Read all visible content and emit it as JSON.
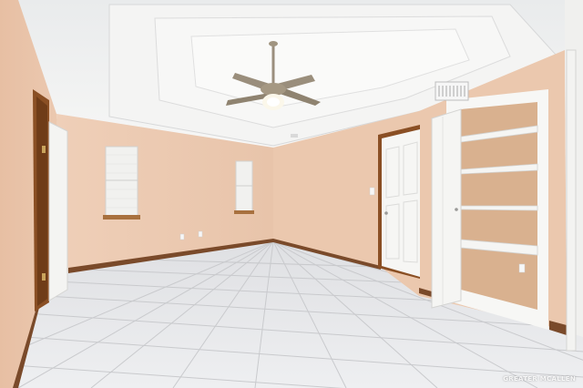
{
  "scene": {
    "type": "photo",
    "subject": "empty-room-interior"
  },
  "watermark": {
    "text": "GREATER MCALLEN"
  },
  "colors": {
    "wall": "#e9c9b2",
    "wall_shadow": "#d9b49b",
    "ceiling": "#f2f2f0",
    "floor_tile": "#e6e7e9",
    "grout": "#c8c9cc",
    "baseboard": "#7a4a2a",
    "door_white": "#f5f5f3",
    "door_wood": "#8a4f24"
  }
}
